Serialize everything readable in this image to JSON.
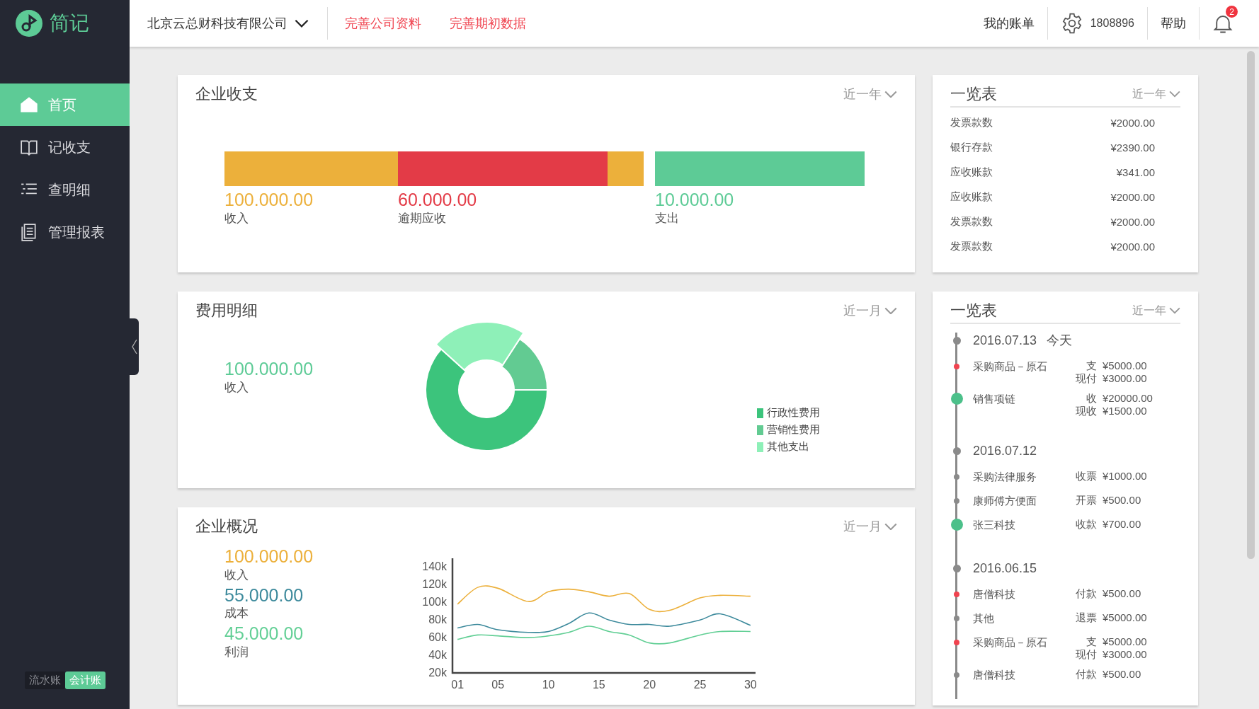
{
  "sidebar": {
    "logo": "简记",
    "nav": [
      {
        "label": "首页",
        "selected": true
      },
      {
        "label": "记收支",
        "selected": false
      },
      {
        "label": "查明细",
        "selected": false
      },
      {
        "label": "管理报表",
        "selected": false
      }
    ],
    "mode_toggle": [
      {
        "label": "流水账",
        "selected": false
      },
      {
        "label": "会计账",
        "selected": true
      }
    ]
  },
  "topbar": {
    "company": "北京云总财科技有限公司",
    "links": [
      "完善公司资料",
      "完善期初数据"
    ],
    "bill": "我的账单",
    "account": "1808896",
    "help": "帮助",
    "notifications": "2"
  },
  "income_card": {
    "title": "企业收支",
    "period": "近一年",
    "figures": [
      {
        "value": "100.000.00",
        "label": "收入",
        "color": "#ecb03b"
      },
      {
        "value": "60.000.00",
        "label": "逾期应收",
        "color": "#e33b47"
      },
      {
        "value": "10.000.00",
        "label": "支出",
        "color": "#5dcb96"
      }
    ]
  },
  "expense_card": {
    "title": "费用明细",
    "period": "近一月",
    "total": {
      "value": "100.000.00",
      "label": "收入"
    },
    "legend": [
      {
        "label": "行政性费用",
        "color": "#3cc47c"
      },
      {
        "label": "营销性费用",
        "color": "#62cb92"
      },
      {
        "label": "其他支出",
        "color": "#8ef0b8"
      }
    ]
  },
  "overview_card": {
    "title": "企业概况",
    "period": "近一月",
    "figures": [
      {
        "value": "100.000.00",
        "label": "收入",
        "color": "#ecb03b"
      },
      {
        "value": "55.000.00",
        "label": "成本",
        "color": "#3d8a9c"
      },
      {
        "value": "45.000.00",
        "label": "利润",
        "color": "#62cf95"
      }
    ],
    "chart_data": {
      "type": "line",
      "x": [
        1,
        3,
        5,
        8,
        10,
        12,
        14,
        16,
        18,
        20,
        22,
        25,
        27,
        30
      ],
      "series": [
        {
          "color": "#ecb03b",
          "values": [
            98000,
            117000,
            116000,
            101000,
            112000,
            115000,
            112000,
            107000,
            110000,
            92000,
            91000,
            105000,
            108000,
            107000
          ]
        },
        {
          "color": "#3d8a9c",
          "values": [
            71000,
            75000,
            69000,
            66000,
            67000,
            76000,
            88000,
            80000,
            75000,
            75000,
            73000,
            80000,
            87000,
            74000
          ]
        },
        {
          "color": "#62cf95",
          "values": [
            58000,
            63000,
            62000,
            60000,
            62000,
            66000,
            73000,
            67000,
            63000,
            54000,
            54000,
            63000,
            67000,
            67000
          ]
        }
      ],
      "xlim": [
        0.5,
        30.5
      ],
      "ylim": [
        20000,
        150000
      ],
      "xticks": [
        {
          "value": 1,
          "label": "01"
        },
        {
          "value": 5,
          "label": "05"
        },
        10,
        15,
        20,
        25,
        30
      ],
      "yticks": [
        {
          "value": 20000,
          "label": "20k"
        },
        {
          "value": 40000,
          "label": "40k"
        },
        {
          "value": 60000,
          "label": "60k"
        },
        {
          "value": 80000,
          "label": "80k"
        },
        {
          "value": 100000,
          "label": "100k"
        },
        {
          "value": 120000,
          "label": "120k"
        },
        {
          "value": 140000,
          "label": "140k"
        }
      ]
    }
  },
  "summary_card": {
    "title": "一览表",
    "period": "近一年",
    "rows": [
      {
        "label": "发票款数",
        "amount": "¥2000.00"
      },
      {
        "label": "银行存款",
        "amount": "¥2390.00"
      },
      {
        "label": "应收账款",
        "amount": "¥341.00"
      },
      {
        "label": "应收账款",
        "amount": "¥2000.00"
      },
      {
        "label": "发票款数",
        "amount": "¥2000.00"
      },
      {
        "label": "发票款数",
        "amount": "¥2000.00"
      }
    ]
  },
  "timeline_card": {
    "title": "一览表",
    "period": "近一年",
    "groups": [
      {
        "date": "2016.07.13",
        "note": "今天",
        "entries": [
          {
            "name": "采购商品－原石",
            "kind": "small",
            "color": "#f0434f",
            "lines": [
              {
                "type": "支",
                "amount": "¥5000.00"
              },
              {
                "type": "现付",
                "amount": "¥3000.00"
              }
            ]
          },
          {
            "name": "销售项链",
            "kind": "large",
            "color": "#4cc08a",
            "lines": [
              {
                "type": "收",
                "amount": "¥20000.00"
              },
              {
                "type": "现收",
                "amount": "¥1500.00"
              }
            ]
          }
        ]
      },
      {
        "date": "2016.07.12",
        "entries": [
          {
            "name": "采购法律服务",
            "kind": "small",
            "color": "#8a8a8a",
            "lines": [
              {
                "type": "收票",
                "amount": "¥1000.00"
              }
            ]
          },
          {
            "name": "康师傅方便面",
            "kind": "small",
            "color": "#8a8a8a",
            "lines": [
              {
                "type": "开票",
                "amount": "¥500.00"
              }
            ]
          },
          {
            "name": "张三科技",
            "kind": "large",
            "color": "#4cc08a",
            "lines": [
              {
                "type": "收款",
                "amount": "¥700.00"
              }
            ]
          }
        ]
      },
      {
        "date": "2016.06.15",
        "entries": [
          {
            "name": "唐僧科技",
            "kind": "small",
            "color": "#f0434f",
            "lines": [
              {
                "type": "付款",
                "amount": "¥500.00"
              }
            ]
          },
          {
            "name": "其他",
            "kind": "small",
            "color": "#8a8a8a",
            "lines": [
              {
                "type": "退票",
                "amount": "¥5000.00"
              }
            ]
          },
          {
            "name": "采购商品－原石",
            "kind": "small",
            "color": "#f0434f",
            "lines": [
              {
                "type": "支",
                "amount": "¥5000.00"
              },
              {
                "type": "现付",
                "amount": "¥3000.00"
              }
            ]
          },
          {
            "name": "唐僧科技",
            "kind": "small",
            "color": "#8a8a8a",
            "lines": [
              {
                "type": "付款",
                "amount": "¥500.00"
              }
            ]
          }
        ]
      }
    ]
  }
}
